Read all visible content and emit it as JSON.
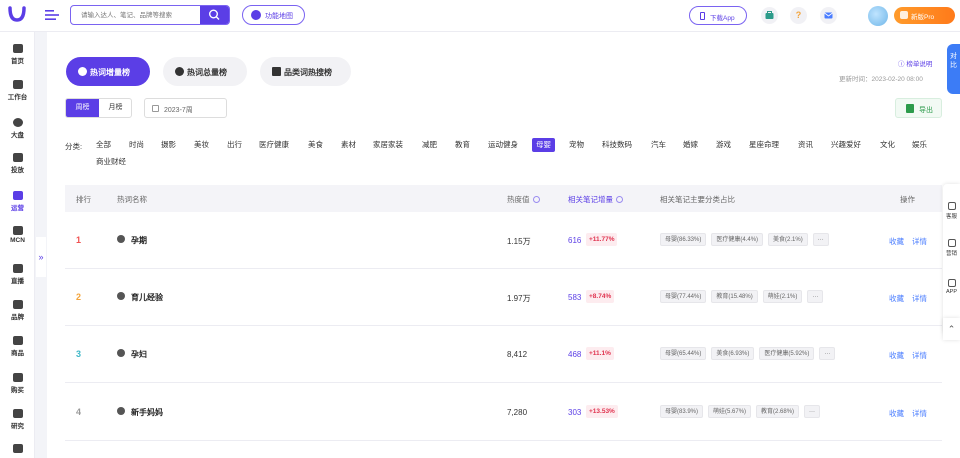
{
  "topbar": {
    "search_placeholder": "请输入达人、笔记、品牌等搜索",
    "map_button": "功能地图",
    "download_button": "下载App",
    "pro_button": "新版Pro",
    "help_icon_text": "?"
  },
  "sidebar": {
    "items": [
      {
        "label": "首页",
        "icon": "home-icon"
      },
      {
        "label": "工作台",
        "icon": "workbench-icon"
      },
      {
        "label": "大盘",
        "icon": "pie-chart-icon"
      },
      {
        "label": "投放",
        "icon": "folder-icon"
      },
      {
        "label": "运营",
        "icon": "trend-icon"
      },
      {
        "label": "MCN",
        "icon": "building-icon"
      },
      {
        "label": "直播",
        "icon": "video-icon"
      },
      {
        "label": "品牌",
        "icon": "brand-icon"
      },
      {
        "label": "商品",
        "icon": "bag-icon"
      },
      {
        "label": "购买",
        "icon": "cart-icon"
      },
      {
        "label": "研究",
        "icon": "flask-icon"
      }
    ],
    "collapse_glyph": "»"
  },
  "tabs": [
    {
      "label": "热词增量榜",
      "active": true
    },
    {
      "label": "热词总量榜",
      "active": false
    },
    {
      "label": "品类词热搜榜",
      "active": false
    }
  ],
  "rule_link": "榜单说明",
  "updated_time": "更新时间：2023-02-20 08:00",
  "period": {
    "week": "周榜",
    "month": "月榜"
  },
  "date_value": "2023-7周",
  "export_label": "导出",
  "category_label": "分类:",
  "categories": [
    "全部",
    "时尚",
    "摄影",
    "美妆",
    "出行",
    "医疗健康",
    "美食",
    "素材",
    "家居家装",
    "减肥",
    "教育",
    "运动健身",
    "母婴",
    "宠物",
    "科技数码",
    "汽车",
    "婚嫁",
    "游戏",
    "星座命理",
    "资讯",
    "兴趣爱好",
    "文化",
    "娱乐",
    "商业财经"
  ],
  "active_category": "母婴",
  "table": {
    "headers": {
      "rank": "排行",
      "name": "热词名称",
      "heat": "热度值",
      "notes": "相关笔记增量",
      "share": "相关笔记主要分类占比",
      "action": "操作"
    },
    "rows": [
      {
        "rank": "1",
        "rank_color": "#f05252",
        "keyword": "孕期",
        "heat": "1.15万",
        "notes": "616",
        "growth": "+11.77%",
        "chips": [
          "母婴(86.33%)",
          "医疗健康(4.4%)",
          "美食(2.1%)",
          "···"
        ],
        "collect": "收藏",
        "detail": "详情"
      },
      {
        "rank": "2",
        "rank_color": "#f3a43b",
        "keyword": "育儿经验",
        "heat": "1.97万",
        "notes": "583",
        "growth": "+8.74%",
        "chips": [
          "母婴(77.44%)",
          "教育(15.48%)",
          "萌娃(2.1%)",
          "···"
        ],
        "collect": "收藏",
        "detail": "详情"
      },
      {
        "rank": "3",
        "rank_color": "#3fb7c7",
        "keyword": "孕妇",
        "heat": "8,412",
        "notes": "468",
        "growth": "+11.1%",
        "chips": [
          "母婴(65.44%)",
          "美食(6.93%)",
          "医疗健康(5.92%)",
          "···"
        ],
        "collect": "收藏",
        "detail": "详情"
      },
      {
        "rank": "4",
        "rank_color": "#999999",
        "keyword": "新手妈妈",
        "heat": "7,280",
        "notes": "303",
        "growth": "+13.53%",
        "chips": [
          "母婴(83.9%)",
          "萌娃(5.67%)",
          "教育(2.68%)",
          "···"
        ],
        "collect": "收藏",
        "detail": "详情"
      }
    ]
  },
  "right_float": [
    {
      "label": "客服",
      "icon": "headset-icon"
    },
    {
      "label": "营销",
      "icon": "monitor-icon"
    },
    {
      "label": "APP",
      "icon": "phone-icon"
    }
  ],
  "right_blue_tab": "对比",
  "colors": {
    "accent": "#5b3ee6",
    "link": "#4a7dff",
    "growth": "#e0334f"
  }
}
